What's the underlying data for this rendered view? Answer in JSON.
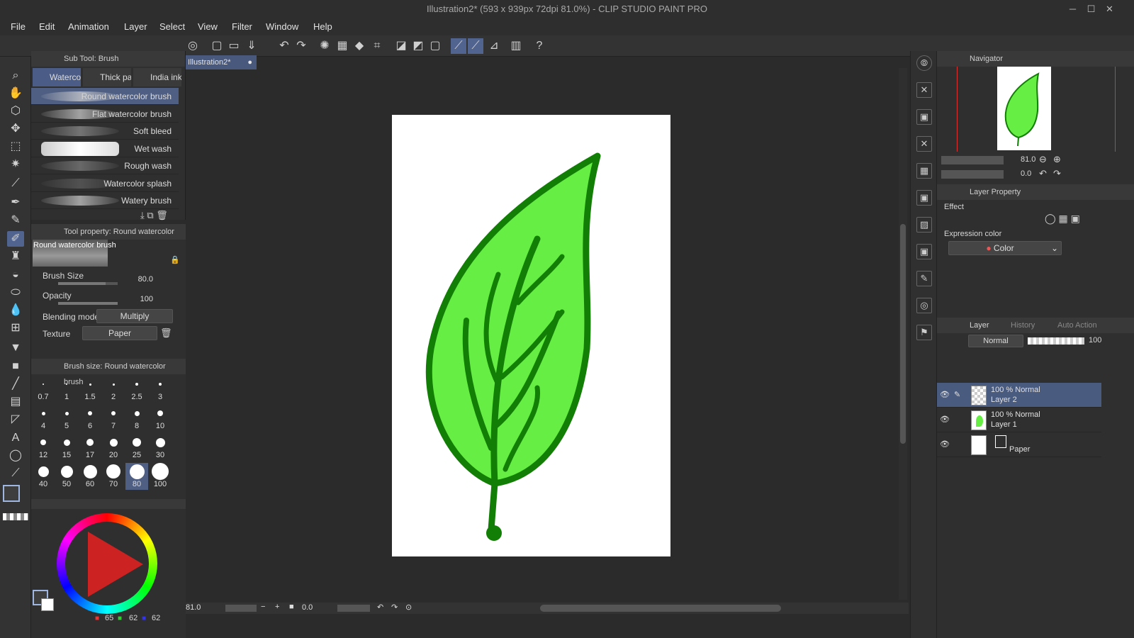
{
  "window": {
    "title": "Illustration2* (593 x 939px 72dpi 81.0%)  - CLIP STUDIO PAINT PRO",
    "min": "─",
    "max": "☐",
    "close": "✕"
  },
  "menu": [
    "File",
    "Edit",
    "Animation",
    "Layer",
    "Select",
    "View",
    "Filter",
    "Window",
    "Help"
  ],
  "subtool": {
    "header": "Sub Tool: Brush",
    "tabs": [
      "Waterco",
      "Thick pa",
      "India ink"
    ],
    "brushes": [
      "Round watercolor brush",
      "Flat watercolor brush",
      "Soft bleed",
      "Wet wash",
      "Rough wash",
      "Watercolor splash",
      "Watery brush"
    ]
  },
  "toolprop": {
    "header": "Tool property: Round watercolor brush",
    "preview_name": "Round watercolor brush",
    "brush_size_label": "Brush Size",
    "brush_size": "80.0",
    "opacity_label": "Opacity",
    "opacity": "100",
    "blend_label": "Blending mode",
    "blend": "Multiply",
    "texture_label": "Texture",
    "texture": "Paper",
    "brush_size_fill": 0.8,
    "opacity_fill": 1.0
  },
  "brushsize": {
    "header": "Brush size: Round watercolor brush",
    "sizes": [
      "0.7",
      "1",
      "1.5",
      "2",
      "2.5",
      "3",
      "4",
      "5",
      "6",
      "7",
      "8",
      "10",
      "12",
      "15",
      "17",
      "20",
      "25",
      "30",
      "40",
      "50",
      "60",
      "70",
      "80",
      "100"
    ]
  },
  "color": {
    "r": "65",
    "g": "62",
    "b": "62"
  },
  "canvas": {
    "tab": "Illustration2*",
    "zoom": "81.0",
    "angle": "0.0"
  },
  "navigator": {
    "tab": "Navigator",
    "zoom": "81.0",
    "angle": "0.0"
  },
  "layerprop": {
    "tab": "Layer Property",
    "effect_label": "Effect",
    "expression_label": "Expression color",
    "expression_value": "Color"
  },
  "layers": {
    "tabs": [
      "Layer",
      "History",
      "Auto Action"
    ],
    "blend": "Normal",
    "opacity": "100",
    "items": [
      {
        "mode": "100 % Normal",
        "name": "Layer 2"
      },
      {
        "mode": "100 % Normal",
        "name": "Layer 1"
      },
      {
        "mode": "",
        "name": "Paper"
      }
    ]
  }
}
